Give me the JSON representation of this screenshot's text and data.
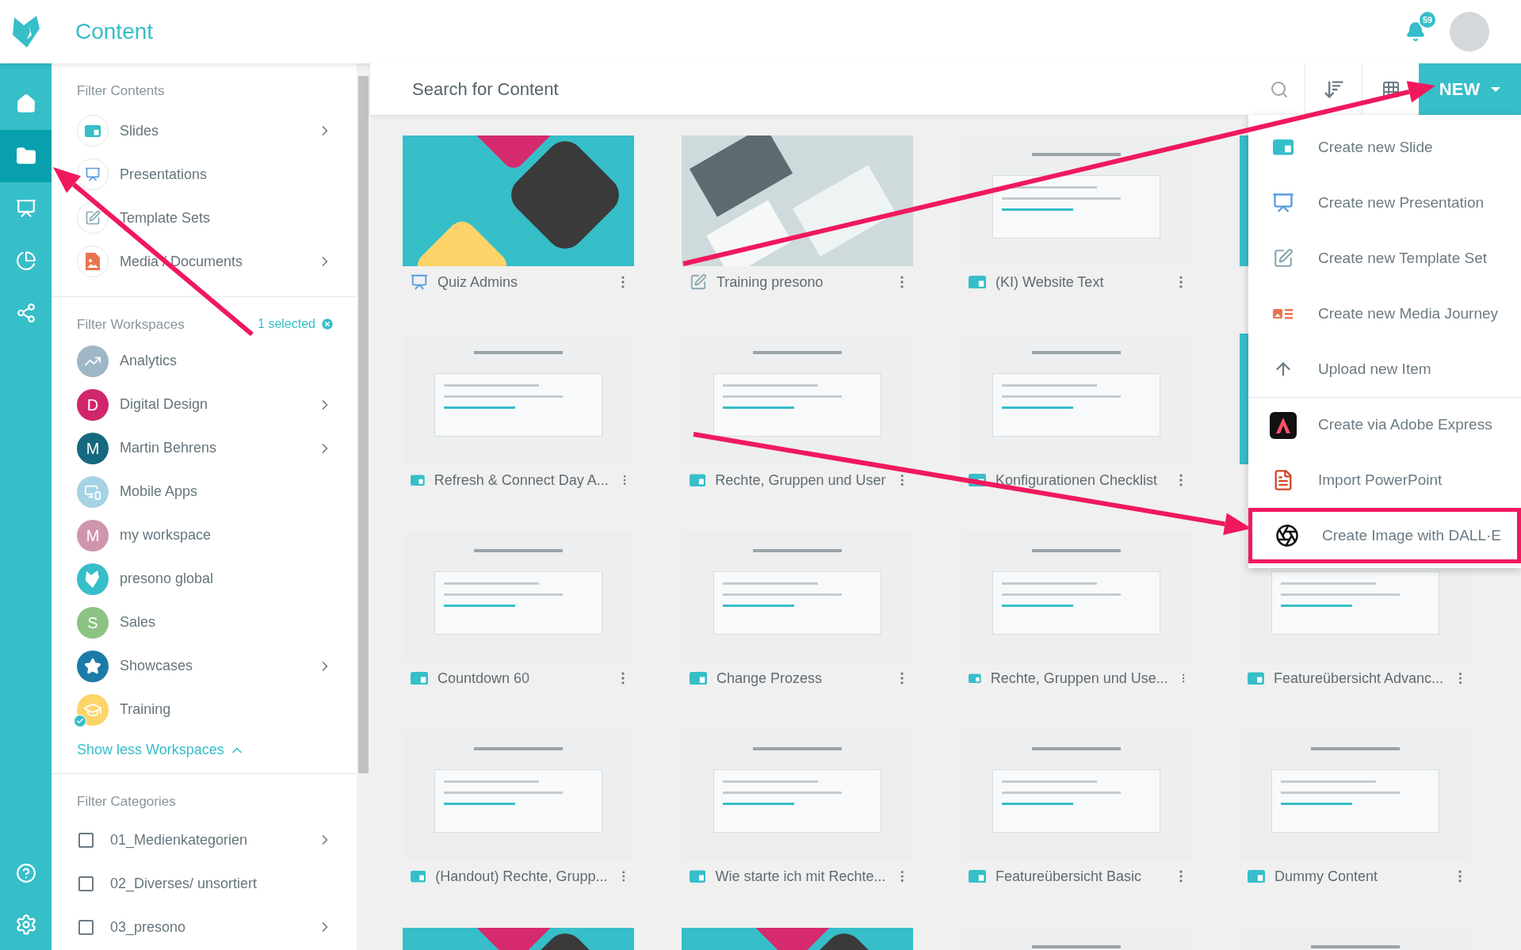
{
  "header": {
    "title": "Content",
    "notifications": "59"
  },
  "rail": [
    {
      "selected": false
    },
    {
      "selected": true
    },
    {
      "selected": false
    },
    {
      "selected": false
    },
    {
      "selected": false
    }
  ],
  "filter_contents": {
    "title": "Filter Contents",
    "items": [
      {
        "label": "Slides",
        "expandable": true
      },
      {
        "label": "Presentations",
        "expandable": false
      },
      {
        "label": "Template Sets",
        "expandable": false
      },
      {
        "label": "Media / Documents",
        "expandable": true
      }
    ]
  },
  "filter_workspaces": {
    "title": "Filter Workspaces",
    "selected_count": "1 selected",
    "items": [
      {
        "label": "Analytics",
        "color": "#9fb6c6",
        "expandable": false,
        "selected": false
      },
      {
        "label": "Digital Design",
        "color": "#d0266c",
        "initial": "D",
        "expandable": true,
        "selected": false
      },
      {
        "label": "Martin Behrens",
        "color": "#16687e",
        "initial": "M",
        "expandable": true,
        "selected": false
      },
      {
        "label": "Mobile Apps",
        "color": "#a5d3e3",
        "expandable": false,
        "selected": false
      },
      {
        "label": "my workspace",
        "color": "#cf95ad",
        "initial": "M",
        "expandable": false,
        "selected": false
      },
      {
        "label": "presono global",
        "color": "#36bec9",
        "expandable": false,
        "selected": false
      },
      {
        "label": "Sales",
        "color": "#8cc283",
        "initial": "S",
        "expandable": false,
        "selected": false
      },
      {
        "label": "Showcases",
        "color": "#1a7ba8",
        "expandable": true,
        "selected": false
      },
      {
        "label": "Training",
        "color": "#fdd469",
        "expandable": false,
        "selected": true
      }
    ],
    "toggle": "Show less Workspaces"
  },
  "filter_categories": {
    "title": "Filter Categories",
    "items": [
      {
        "label": "01_Medienkategorien",
        "checked": false,
        "expandable": true
      },
      {
        "label": "02_Diverses/ unsortiert",
        "checked": false,
        "expandable": false
      },
      {
        "label": "03_presono",
        "checked": false,
        "expandable": true
      }
    ]
  },
  "search": {
    "placeholder": "Search for Content"
  },
  "new_button": "NEW",
  "new_menu": [
    {
      "label": "Create new Slide",
      "highlighted": false
    },
    {
      "label": "Create new Presentation",
      "highlighted": false
    },
    {
      "label": "Create new Template Set",
      "highlighted": false
    },
    {
      "label": "Create new Media Journey",
      "highlighted": false
    },
    {
      "label": "Upload new Item",
      "highlighted": false
    },
    {
      "label": "Create via Adobe Express",
      "highlighted": false
    },
    {
      "label": "Import PowerPoint",
      "highlighted": false
    },
    {
      "label": "Create Image with DALL·E",
      "highlighted": true
    }
  ],
  "cards": [
    {
      "title": "Quiz Admins",
      "kind": "presentation",
      "thumbnail": {
        "kind": "teal"
      }
    },
    {
      "title": "Training presono",
      "kind": "template",
      "thumbnail": {
        "kind": "photo"
      }
    },
    {
      "title": "(KI) Website Text",
      "kind": "slide",
      "thumbnail": {
        "kind": "light"
      }
    },
    {
      "thumbnail": {
        "kind": "teal"
      }
    },
    {
      "title": "Refresh & Connect Day A...",
      "kind": "slide",
      "thumbnail": {
        "kind": "light"
      }
    },
    {
      "title": "Rechte, Gruppen und User",
      "kind": "slide",
      "thumbnail": {
        "kind": "light"
      }
    },
    {
      "title": "Konfigurationen Checklist",
      "kind": "slide",
      "thumbnail": {
        "kind": "light"
      }
    },
    {
      "thumbnail": {
        "kind": "teal"
      }
    },
    {
      "title": "Countdown 60",
      "kind": "slide",
      "thumbnail": {
        "kind": "light"
      }
    },
    {
      "title": "Change Prozess",
      "kind": "slide",
      "thumbnail": {
        "kind": "light"
      }
    },
    {
      "title": "Rechte, Gruppen und Use...",
      "kind": "slide",
      "thumbnail": {
        "kind": "light"
      }
    },
    {
      "title": "Featureübersicht Advanc...",
      "kind": "slide",
      "thumbnail": {
        "kind": "light"
      }
    },
    {
      "title": "(Handout) Rechte, Grupp...",
      "kind": "slide",
      "thumbnail": {
        "kind": "light"
      }
    },
    {
      "title": "Wie starte ich mit Rechte...",
      "kind": "slide",
      "thumbnail": {
        "kind": "light"
      }
    },
    {
      "title": "Featureübersicht Basic",
      "kind": "slide",
      "thumbnail": {
        "kind": "light"
      }
    },
    {
      "title": "Dummy Content",
      "kind": "slide",
      "thumbnail": {
        "kind": "light"
      }
    },
    {
      "thumbnail": {
        "kind": "teal"
      }
    },
    {
      "thumbnail": {
        "kind": "teal"
      }
    },
    {
      "thumbnail": {
        "kind": "light"
      }
    },
    {
      "thumbnail": {
        "kind": "light"
      }
    }
  ]
}
